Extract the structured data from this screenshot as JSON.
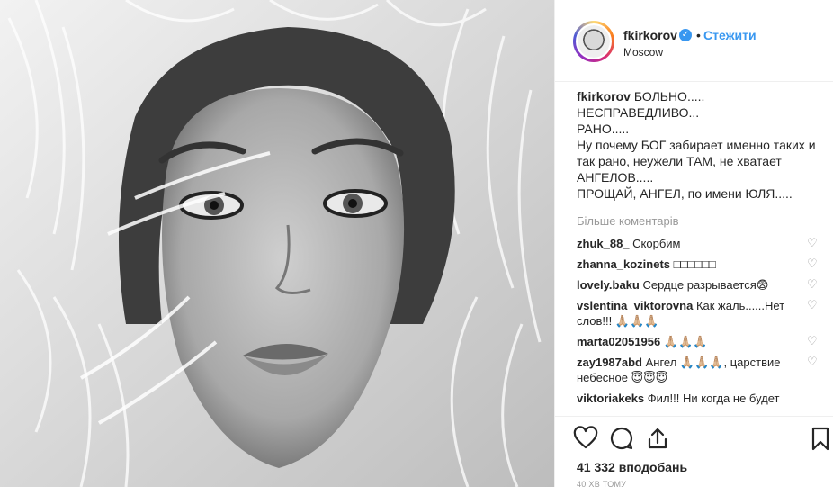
{
  "post": {
    "photo_icon": "portrait-photo",
    "photo_alt": ""
  },
  "header": {
    "username": "fkirkorov",
    "verified_icon": "verified-badge-icon",
    "follow_separator": "•",
    "follow_label": "Стежити",
    "location": "Moscow"
  },
  "caption": {
    "username": "fkirkorov",
    "lines": [
      "БОЛЬНО.....",
      "НЕСПРАВЕДЛИВО...",
      "РАНО.....",
      "Ну почему БОГ забирает именно таких и",
      "так рано, неужели ТАМ, не хватает",
      "АНГЕЛОВ.....",
      "ПРОЩАЙ, АНГЕЛ, по имени ЮЛЯ....."
    ]
  },
  "more_comments_label": "Більше коментарів",
  "comments": [
    {
      "user": "zhuk_88_",
      "text": "Скорбим"
    },
    {
      "user": "zhanna_kozinets",
      "text": "□□□□□□"
    },
    {
      "user": "lovely.baku",
      "text": "Сердце разрывается😨"
    },
    {
      "user": "vslentina_viktorovna",
      "text": "Как жаль......Нет слов!!! 🙏🏼🙏🏼🙏🏼"
    },
    {
      "user": "marta02051956",
      "text": "🙏🏼🙏🏼🙏🏼"
    },
    {
      "user": "zay1987abd",
      "text": "Ангел 🙏🏼🙏🏼🙏🏼, царствие небесное 😇😇😇"
    },
    {
      "user": "viktoriakeks",
      "text": "Фил!!! Ни когда не будет"
    }
  ],
  "actions": {
    "like_icon": "heart-outline-icon",
    "comment_icon": "comment-bubble-icon",
    "share_icon": "share-upload-icon",
    "save_icon": "bookmark-icon"
  },
  "likes_text": "41 332 вподобань",
  "timestamp": "40 ХВ ТОМУ",
  "colors": {
    "link_blue": "#3897f0",
    "text": "#262626",
    "muted": "#999999"
  }
}
